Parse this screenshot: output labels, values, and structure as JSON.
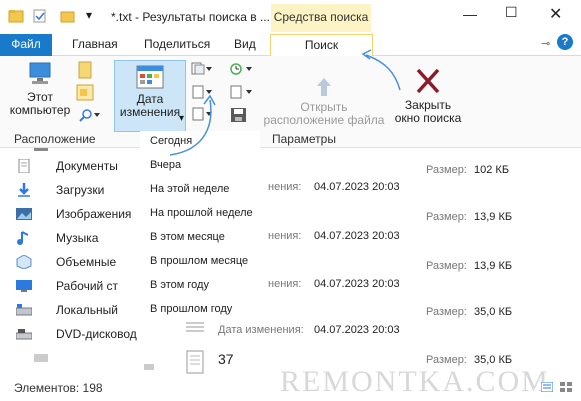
{
  "window": {
    "title": "*.txt - Результаты поиска в ...",
    "contextual_group": "Средства поиска"
  },
  "ribbon_tabs": {
    "file": "Файл",
    "home": "Главная",
    "share": "Поделиться",
    "view": "Вид",
    "search": "Поиск"
  },
  "ribbon": {
    "this_pc_line1": "Этот",
    "this_pc_line2": "компьютер",
    "date_modified_line1": "Дата",
    "date_modified_line2": "изменения",
    "open_location_line1": "Открыть",
    "open_location_line2": "расположение файла",
    "close_search_line1": "Закрыть",
    "close_search_line2": "окно поиска",
    "group_location": "Расположение",
    "group_options": "Параметры"
  },
  "date_dropdown": {
    "items": [
      "Сегодня",
      "Вчера",
      "На этой неделе",
      "На прошлой неделе",
      "В этом месяце",
      "В прошлом месяце",
      "В этом году",
      "В прошлом году"
    ]
  },
  "nav": {
    "items": [
      {
        "label": "Документы",
        "icon": "documents-icon"
      },
      {
        "label": "Загрузки",
        "icon": "downloads-icon"
      },
      {
        "label": "Изображения",
        "icon": "pictures-icon"
      },
      {
        "label": "Музыка",
        "icon": "music-icon"
      },
      {
        "label": "Объемные",
        "icon": "3d-objects-icon"
      },
      {
        "label": "Рабочий ст",
        "icon": "desktop-icon"
      },
      {
        "label": "Локальный",
        "icon": "local-disk-icon"
      },
      {
        "label": "DVD-дисковод (",
        "icon": "dvd-drive-icon"
      }
    ]
  },
  "results": {
    "modified_label_partial": "нения:",
    "modified_label_full": "Дата изменения:",
    "size_label": "Размер:",
    "rows": [
      {
        "date": "",
        "size": "102 КБ"
      },
      {
        "date": "04.07.2023 20:03",
        "size": ""
      },
      {
        "date": "",
        "size": "13,9 КБ"
      },
      {
        "date": "04.07.2023 20:03",
        "size": ""
      },
      {
        "date": "",
        "size": "13,9 КБ"
      },
      {
        "date": "04.07.2023 20:03",
        "size": ""
      },
      {
        "date": "",
        "size": "35,0 КБ"
      },
      {
        "date": "04.07.2023 20:03",
        "size": ""
      },
      {
        "name": "37",
        "size": "35,0 КБ"
      }
    ]
  },
  "status": {
    "items_count": "Элементов: 198"
  },
  "watermark": "REMONTKA.COM",
  "colors": {
    "accent": "#1979ca",
    "context_tab": "#fdf3c4",
    "arrow_annotation": "#4a90d9",
    "close_x": "#8b1a2b"
  }
}
